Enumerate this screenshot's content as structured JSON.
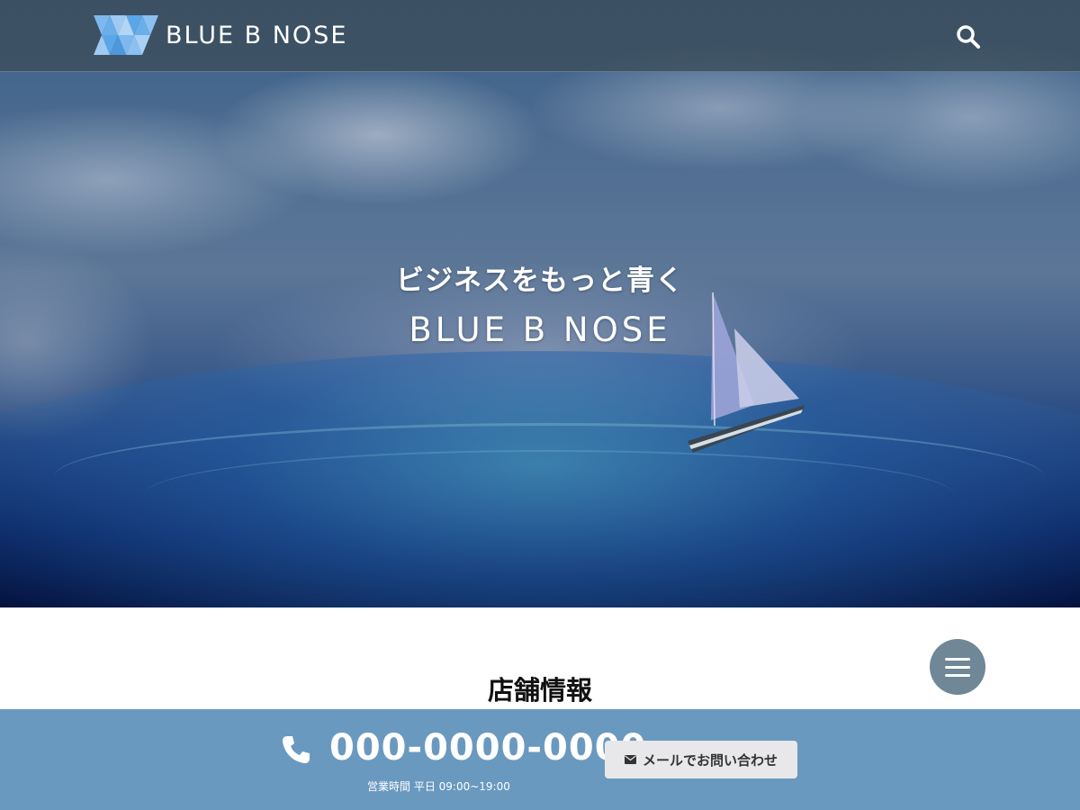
{
  "header": {
    "logo_text": "BLUE B NOSE",
    "search_icon": "search-icon"
  },
  "hero": {
    "subtitle": "ビジネスをもっと青く",
    "title": "BLUE B NOSE"
  },
  "section": {
    "title": "店舗情報"
  },
  "menu": {
    "icon": "hamburger-icon"
  },
  "cta": {
    "phone_icon": "phone-icon",
    "phone_number": "000-0000-0000",
    "hours": "営業時間 平日 09:00~19:00",
    "mail_icon": "mail-icon",
    "mail_label": "メールでお問い合わせ"
  },
  "colors": {
    "header_bg": "#3c4e5c",
    "cta_bg": "#6a99bf",
    "menu_button": "#6f8797",
    "mail_button": "#e8e8ea",
    "logo_blue": "#5aa6e6"
  }
}
